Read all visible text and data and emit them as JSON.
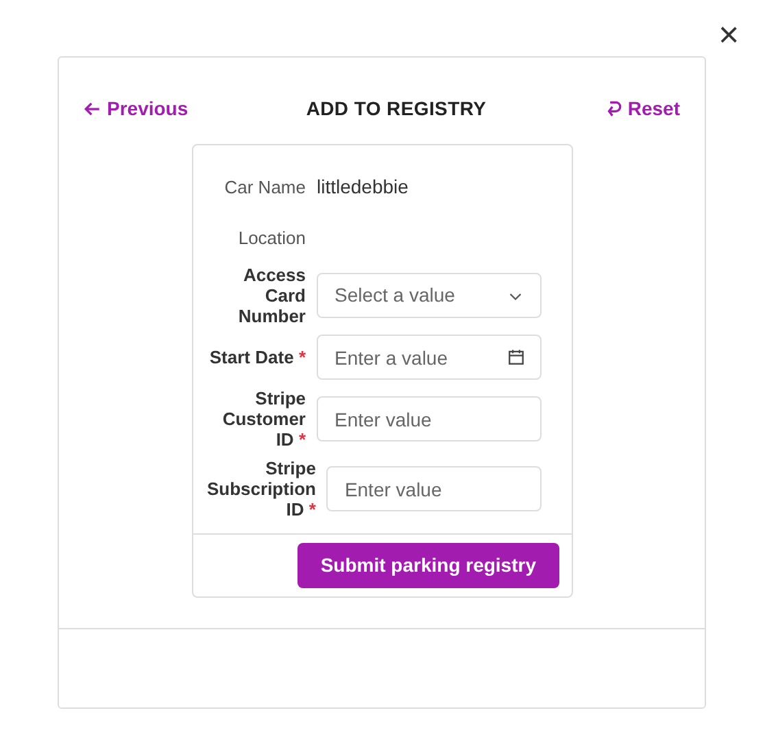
{
  "close_button": "×",
  "header": {
    "previous": "Previous",
    "title": "ADD TO REGISTRY",
    "reset": "Reset"
  },
  "fields": [
    {
      "kind": "static",
      "label": "Car Name",
      "value": "littledebbie",
      "required": false
    },
    {
      "kind": "static",
      "label": "Location",
      "required": false
    },
    {
      "kind": "select",
      "label": "Access Card Number",
      "placeholder": "Select a value",
      "required": false
    },
    {
      "kind": "date",
      "label": "Start Date",
      "placeholder": "Enter a value",
      "required": true
    },
    {
      "kind": "text",
      "label": "Stripe Customer ID",
      "placeholder": "Enter value",
      "required": true
    },
    {
      "kind": "text",
      "label": "Stripe Subscription ID",
      "placeholder": "Enter value",
      "required": true
    }
  ],
  "required_mark": "*",
  "submit_button": "Submit parking registry"
}
